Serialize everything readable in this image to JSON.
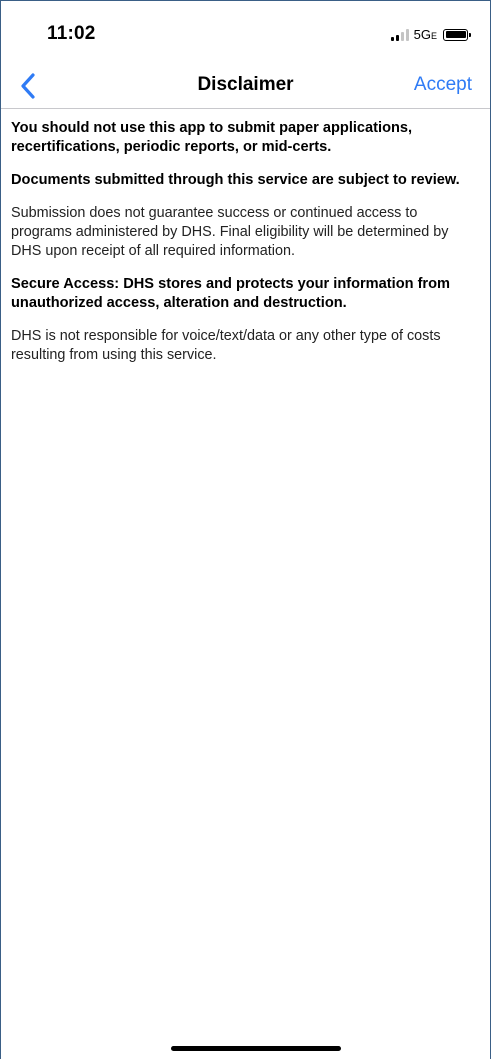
{
  "status_bar": {
    "time": "11:02",
    "network": "5G",
    "network_suffix": "E",
    "icons": [
      "signal-icon",
      "battery-icon"
    ]
  },
  "nav": {
    "back_icon": "chevron-left-icon",
    "title": "Disclaimer",
    "accept_label": "Accept",
    "accent_color": "#2f7bf5"
  },
  "content": {
    "paragraphs": [
      {
        "style": "bold",
        "text": "You should not use this app to submit paper applications, recertifications, periodic reports, or mid-certs."
      },
      {
        "style": "bold",
        "text": "Documents submitted through this service are subject to review."
      },
      {
        "style": "regular",
        "text": "Submission does not guarantee success or continued access to programs administered by DHS. Final eligibility will be determined by DHS upon receipt of all required information."
      },
      {
        "style": "bold",
        "text": "Secure Access: DHS stores and protects your information from unauthorized access, alteration and destruction."
      },
      {
        "style": "regular",
        "text": "DHS is not responsible for voice/text/data or any other type of costs resulting from using this service."
      }
    ]
  }
}
